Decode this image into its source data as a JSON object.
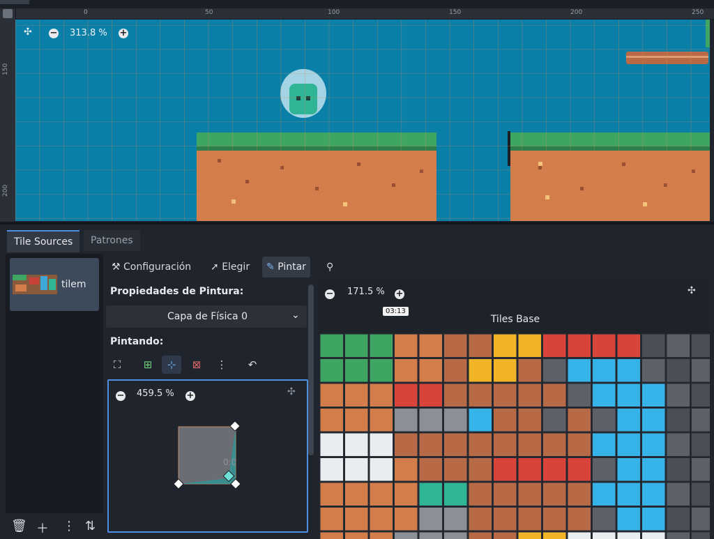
{
  "viewport": {
    "zoom_label": "313.8 %",
    "ruler_h": [
      "0",
      "50",
      "100",
      "150",
      "200",
      "250"
    ],
    "ruler_v": [
      "150",
      "200"
    ]
  },
  "bottom_tabs": [
    "Tile Sources",
    "Patrones"
  ],
  "sources": [
    {
      "label": "tilem"
    }
  ],
  "modes": {
    "config": "Configuración",
    "select": "Elegir",
    "paint": "Pintar"
  },
  "paint_props": {
    "title": "Propiedades de Pintura:",
    "layer": "Capa de Física 0",
    "painting_title": "Pintando:"
  },
  "editor": {
    "zoom_label": "459.5 %",
    "coord_label": "0:0"
  },
  "atlas": {
    "zoom_label": "171.5 %",
    "title": "Tiles Base"
  },
  "video_timestamp": "03:13",
  "colors": {
    "accent": "#4f8ee0",
    "sky": "#0a7fa8",
    "grass": "#3ea563",
    "dirt": "#d27d4a",
    "grid": "#d9895a"
  }
}
